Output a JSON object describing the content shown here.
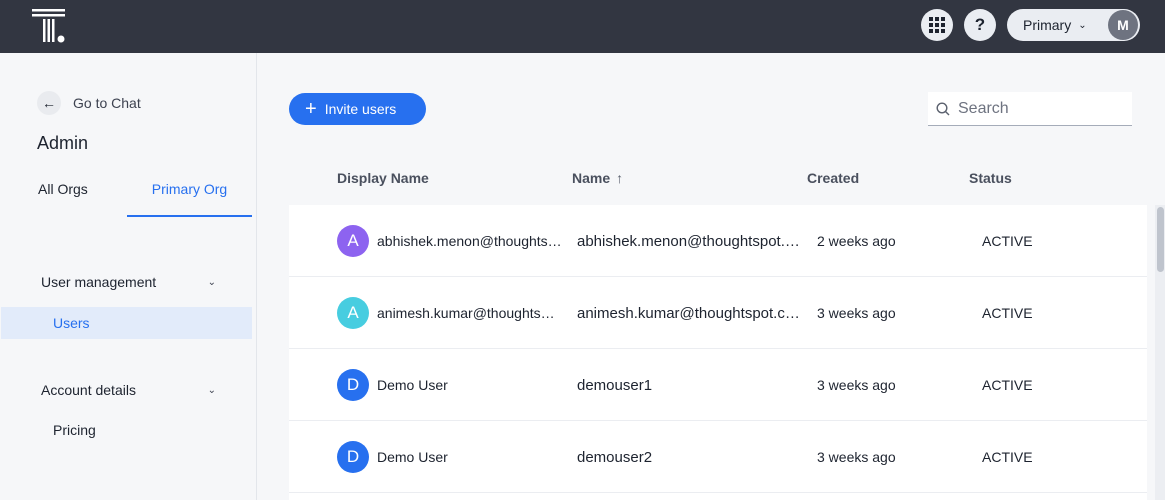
{
  "topbar": {
    "logo": "thoughtspot-logo",
    "apps_icon": "grid-icon",
    "help_label": "?",
    "org_switcher": {
      "label": "Primary",
      "icon": "chevron-down-icon"
    },
    "avatar_initial": "M"
  },
  "sidebar": {
    "back_label": "Go to Chat",
    "title": "Admin",
    "tabs": [
      {
        "label": "All Orgs",
        "active": false
      },
      {
        "label": "Primary Org",
        "active": true
      }
    ],
    "sections": [
      {
        "label": "User management",
        "items": [
          {
            "label": "Users",
            "active": true
          }
        ]
      },
      {
        "label": "Account details",
        "items": [
          {
            "label": "Pricing",
            "active": false
          }
        ]
      }
    ]
  },
  "main": {
    "invite_label": "Invite users",
    "search_placeholder": "Search",
    "columns": {
      "display_name": "Display Name",
      "name": "Name",
      "name_sort": "↑",
      "created": "Created",
      "status": "Status"
    },
    "rows": [
      {
        "initial": "A",
        "avatar_color": "#8d63f0",
        "display_name": "abhishek.menon@thoughtspot.com",
        "name": "abhishek.menon@thoughtspot.com",
        "created": "2 weeks ago",
        "status": "ACTIVE"
      },
      {
        "initial": "A",
        "avatar_color": "#47cde0",
        "display_name": "animesh.kumar@thoughtspot.com",
        "name": "animesh.kumar@thoughtspot.com",
        "created": "3 weeks ago",
        "status": "ACTIVE"
      },
      {
        "initial": "D",
        "avatar_color": "#2770ef",
        "display_name": "Demo User",
        "name": "demouser1",
        "created": "3 weeks ago",
        "status": "ACTIVE"
      },
      {
        "initial": "D",
        "avatar_color": "#2770ef",
        "display_name": "Demo User",
        "name": "demouser2",
        "created": "3 weeks ago",
        "status": "ACTIVE"
      }
    ]
  },
  "colors": {
    "accent": "#2770ef",
    "topbar": "#323641",
    "active_nav_bg": "#e2ebfa"
  }
}
